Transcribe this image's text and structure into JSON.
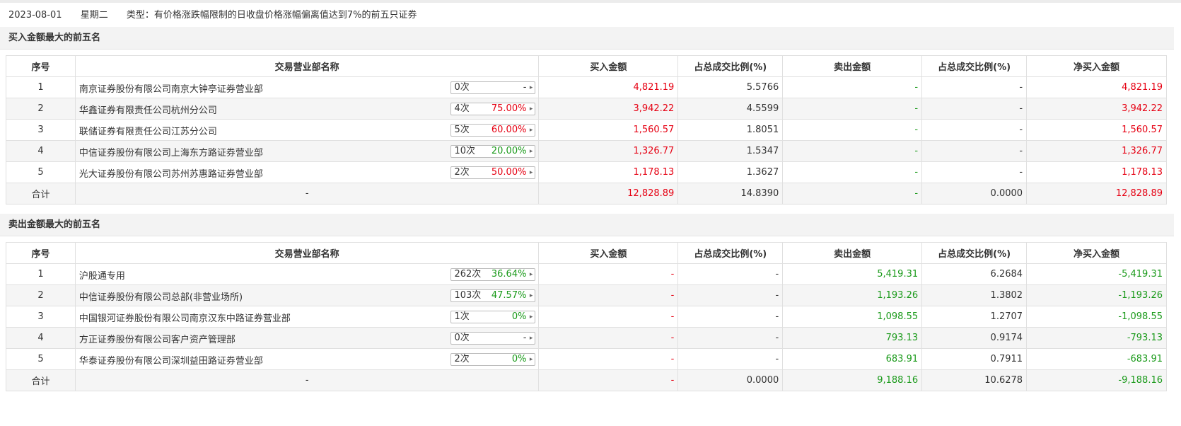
{
  "header": {
    "date": "2023-08-01",
    "weekday": "星期二",
    "type_text": "类型：有价格涨跌幅限制的日收盘价格涨幅偏离值达到7%的前五只证券"
  },
  "colors": {
    "red": "#e60012",
    "green": "#1a9a1a"
  },
  "columns": [
    "序号",
    "交易营业部名称",
    "买入金额",
    "占总成交比例(%)",
    "卖出金额",
    "占总成交比例(%)",
    "净买入金额"
  ],
  "buy": {
    "title": "买入金额最大的前五名",
    "rows": [
      {
        "idx": "1",
        "name": "南京证券股份有限公司南京大钟亭证券营业部",
        "count": "0次",
        "rate": "-",
        "rate_color": "black",
        "buy": "4,821.19",
        "buy_pct": "5.5766",
        "sell": "-",
        "sell_pct": "-",
        "net": "4,821.19"
      },
      {
        "idx": "2",
        "name": "华鑫证券有限责任公司杭州分公司",
        "count": "4次",
        "rate": "75.00%",
        "rate_color": "red",
        "buy": "3,942.22",
        "buy_pct": "4.5599",
        "sell": "-",
        "sell_pct": "-",
        "net": "3,942.22"
      },
      {
        "idx": "3",
        "name": "联储证券有限责任公司江苏分公司",
        "count": "5次",
        "rate": "60.00%",
        "rate_color": "red",
        "buy": "1,560.57",
        "buy_pct": "1.8051",
        "sell": "-",
        "sell_pct": "-",
        "net": "1,560.57"
      },
      {
        "idx": "4",
        "name": "中信证券股份有限公司上海东方路证券营业部",
        "count": "10次",
        "rate": "20.00%",
        "rate_color": "green",
        "buy": "1,326.77",
        "buy_pct": "1.5347",
        "sell": "-",
        "sell_pct": "-",
        "net": "1,326.77"
      },
      {
        "idx": "5",
        "name": "光大证券股份有限公司苏州苏惠路证券营业部",
        "count": "2次",
        "rate": "50.00%",
        "rate_color": "red",
        "buy": "1,178.13",
        "buy_pct": "1.3627",
        "sell": "-",
        "sell_pct": "-",
        "net": "1,178.13"
      }
    ],
    "total": {
      "label": "合计",
      "name": "-",
      "buy": "12,828.89",
      "buy_pct": "14.8390",
      "sell": "-",
      "sell_pct": "0.0000",
      "net": "12,828.89"
    }
  },
  "sell": {
    "title": "卖出金额最大的前五名",
    "rows": [
      {
        "idx": "1",
        "name": "沪股通专用",
        "count": "262次",
        "rate": "36.64%",
        "rate_color": "green",
        "buy": "-",
        "buy_pct": "-",
        "sell": "5,419.31",
        "sell_pct": "6.2684",
        "net": "-5,419.31"
      },
      {
        "idx": "2",
        "name": "中信证券股份有限公司总部(非营业场所)",
        "count": "103次",
        "rate": "47.57%",
        "rate_color": "green",
        "buy": "-",
        "buy_pct": "-",
        "sell": "1,193.26",
        "sell_pct": "1.3802",
        "net": "-1,193.26"
      },
      {
        "idx": "3",
        "name": "中国银河证券股份有限公司南京汉东中路证券营业部",
        "count": "1次",
        "rate": "0%",
        "rate_color": "green",
        "buy": "-",
        "buy_pct": "-",
        "sell": "1,098.55",
        "sell_pct": "1.2707",
        "net": "-1,098.55"
      },
      {
        "idx": "4",
        "name": "方正证券股份有限公司客户资产管理部",
        "count": "0次",
        "rate": "-",
        "rate_color": "black",
        "buy": "-",
        "buy_pct": "-",
        "sell": "793.13",
        "sell_pct": "0.9174",
        "net": "-793.13"
      },
      {
        "idx": "5",
        "name": "华泰证券股份有限公司深圳益田路证券营业部",
        "count": "2次",
        "rate": "0%",
        "rate_color": "green",
        "buy": "-",
        "buy_pct": "-",
        "sell": "683.91",
        "sell_pct": "0.7911",
        "net": "-683.91"
      }
    ],
    "total": {
      "label": "合计",
      "name": "-",
      "buy": "-",
      "buy_pct": "0.0000",
      "sell": "9,188.16",
      "sell_pct": "10.6278",
      "net": "-9,188.16"
    }
  }
}
